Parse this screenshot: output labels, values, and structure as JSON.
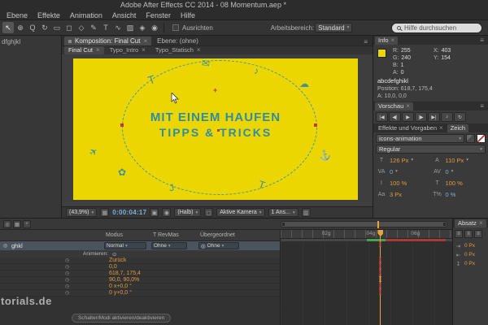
{
  "ui": {
    "close": "×",
    "menu": "≡",
    "caret": "▾",
    "kf": "I",
    "plus": "+",
    "target": "◎",
    "animate_icon": "⊙",
    "stopwatch": "◷"
  },
  "colors": {
    "comp_yellow": "#ecd602",
    "text_teal": "#2d8da3",
    "value_orange": "#e09a3c",
    "value_blue": "#7ab0d8",
    "keyframe_red": "#cf5040",
    "render_green": "#4aa34a",
    "playhead_orange": "#e8a33d"
  },
  "titlebar": {
    "title": "Adobe After Effects CC 2014 - 08 Momentum.aep *"
  },
  "menubar": {
    "items": [
      "Ebene",
      "Effekte",
      "Animation",
      "Ansicht",
      "Fenster",
      "Hilfe"
    ]
  },
  "toolbar": {
    "tools": [
      "↖",
      "⊕",
      "Q",
      "↻",
      "▭",
      "◻",
      "◇",
      "✎",
      "T",
      "∿",
      "▨",
      "◈",
      "◉"
    ],
    "snap_label": "Ausrichten",
    "workspace_label": "Arbeitsbereich:",
    "workspace_value": "Standard",
    "search_placeholder": "Hilfe durchsuchen"
  },
  "left_panel": {
    "text": "dfghjkl"
  },
  "comp": {
    "panel_tabs": [
      {
        "label": "Komposition: Final Cut"
      },
      {
        "label": "Ebene: (ohne)"
      }
    ],
    "tabs": [
      "Final Cut",
      "Typo_Intro",
      "Typo_Statisch"
    ],
    "canvas": {
      "line1": "MIT EINEM HAUFEN",
      "line2": "TIPPS & TRICKS"
    },
    "doodles": [
      "T",
      "✉",
      "♪",
      "☁",
      "⚓",
      "✈",
      "T",
      "J",
      "✿"
    ],
    "status": {
      "zoom": "(43,9%)",
      "timecode": "0:00:04:17",
      "resolution": "(Halb)",
      "camera": "Aktive Kamera",
      "views": "1 Ans...",
      "icons": [
        "▦",
        "▣",
        "◉",
        "◻",
        "▥"
      ]
    }
  },
  "info": {
    "title": "Info",
    "rgba": [
      [
        "R:",
        "255"
      ],
      [
        "G:",
        "240"
      ],
      [
        "B:",
        "1"
      ],
      [
        "A:",
        "0"
      ]
    ],
    "xy": [
      [
        "X:",
        "403"
      ],
      [
        "Y:",
        "154"
      ]
    ],
    "sample": "abcdefghikl",
    "position": "Position: 618,7, 175,4",
    "extra": "A: 10,0, 0,0"
  },
  "preview": {
    "title": "Vorschau",
    "buttons": [
      "|◀",
      "◀|",
      "▶",
      "|▶",
      "▶|",
      "♪",
      "↻"
    ]
  },
  "fx": {
    "tab1": "Effekte und Vorgaben",
    "tab2": "Zeich"
  },
  "character": {
    "font": "icons-animation",
    "style": "Regular",
    "rows": [
      {
        "licon": "T",
        "lval": "126 Px",
        "ricon": "A",
        "rval": "110 Px"
      },
      {
        "licon": "VA",
        "lval": "0",
        "ricon": "AV",
        "rval": "0"
      },
      {
        "licon": "I",
        "lval": "100 %",
        "ricon": "T",
        "rval": "100 %"
      },
      {
        "licon": "Aa",
        "lval": "3 Px",
        "ricon": "T%",
        "rval": "0 %"
      }
    ]
  },
  "paragraph": {
    "title": "Absatz",
    "align_icons": [
      "≡",
      "≡",
      "≡"
    ],
    "rows": [
      [
        "⇥",
        "0 Px"
      ],
      [
        "⇤",
        "0 Px"
      ],
      [
        "↧",
        "0 Px"
      ]
    ]
  },
  "timeline": {
    "top_icons": [
      "◎",
      "▦",
      "+"
    ],
    "columns": {
      "mode": "Modus",
      "trkmat": "T RevMas",
      "parent": "Übergeordnet"
    },
    "layer": {
      "name": "ghkl",
      "mode": "Normal",
      "trkmat": "Ohne",
      "parent": "Ohne"
    },
    "animate_label": "Animieren:",
    "props": [
      "Zurück",
      "0,0",
      "618,7, 175,4",
      "90,0, 90,0%",
      "0 x+0,0 °",
      "0 y+0,0 °"
    ],
    "ruler_labels": [
      "02g",
      "04g",
      "06g"
    ],
    "toggle_label": "Schalter/Modi aktivieren/deaktivieren",
    "watermark": "torials.de"
  }
}
